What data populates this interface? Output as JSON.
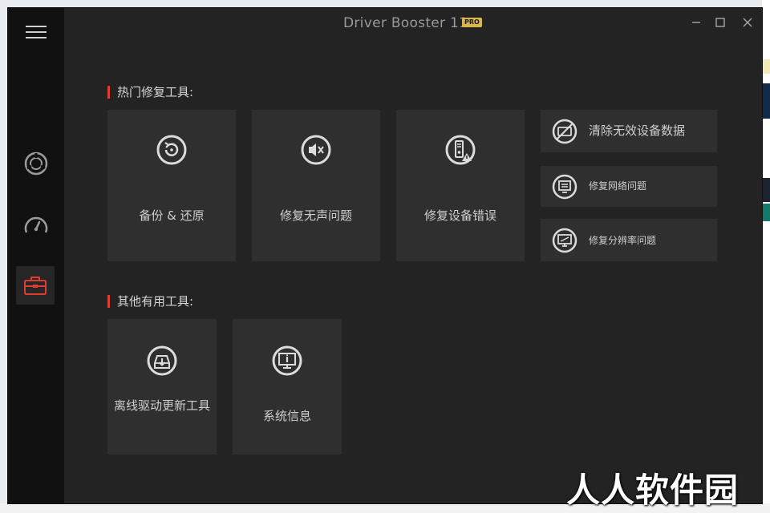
{
  "app": {
    "title": "Driver Booster 11",
    "badge": "PRO"
  },
  "sidebar": {
    "items": [
      {
        "icon": "scan-icon"
      },
      {
        "icon": "speedometer-icon"
      },
      {
        "icon": "toolbox-icon",
        "active": true
      }
    ]
  },
  "sections": {
    "popular": {
      "title": "热门修复工具:",
      "tiles": [
        {
          "label": "备份 & 还原",
          "icon": "backup-restore-icon"
        },
        {
          "label": "修复无声问题",
          "icon": "sound-mute-icon"
        },
        {
          "label": "修复设备错误",
          "icon": "device-error-icon"
        }
      ],
      "small_tiles": [
        {
          "label": "清除无效设备数据",
          "icon": "clean-device-icon"
        },
        {
          "label": "修复网络问题",
          "icon": "network-icon"
        },
        {
          "label": "修复分辨率问题",
          "icon": "resolution-icon"
        }
      ]
    },
    "other": {
      "title": "其他有用工具:",
      "tiles": [
        {
          "label": "离线驱动更新工具",
          "icon": "offline-update-icon"
        },
        {
          "label": "系统信息",
          "icon": "system-info-icon"
        }
      ]
    }
  },
  "watermark": "人人软件园",
  "colors": {
    "accent": "#e03c31",
    "badge": "#d9b64c",
    "window_bg": "#232323",
    "sidebar_bg": "#111111",
    "tile_bg": "#2f2f2f"
  }
}
